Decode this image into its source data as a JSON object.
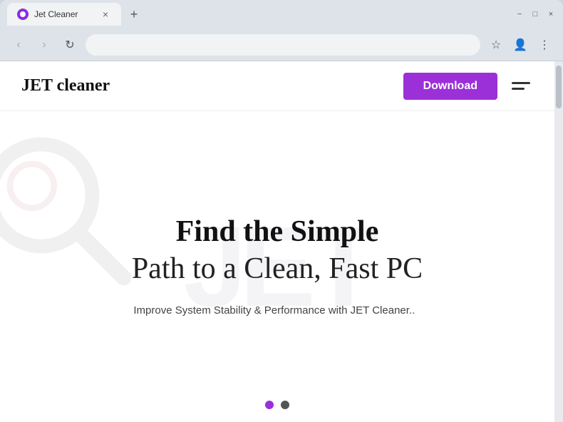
{
  "browser": {
    "tab_title": "Jet Cleaner",
    "close_tab": "×",
    "new_tab": "+",
    "back_btn": "‹",
    "forward_btn": "›",
    "refresh_btn": "↻",
    "address_url": "",
    "address_placeholder": "",
    "window_min": "−",
    "window_max": "□",
    "window_close": "×"
  },
  "site": {
    "logo": "JET cleaner",
    "download_btn": "Download",
    "hero_title_bold": "Find the Simple",
    "hero_title_normal": "Path to a Clean, Fast PC",
    "hero_subtitle": "Improve System Stability & Performance with JET Cleaner..",
    "watermark_text": "JET",
    "dot1_label": "slide 1",
    "dot2_label": "slide 2"
  },
  "colors": {
    "accent": "#9b30d9",
    "dot_active": "#9b30d9",
    "dot_inactive": "#555555"
  }
}
